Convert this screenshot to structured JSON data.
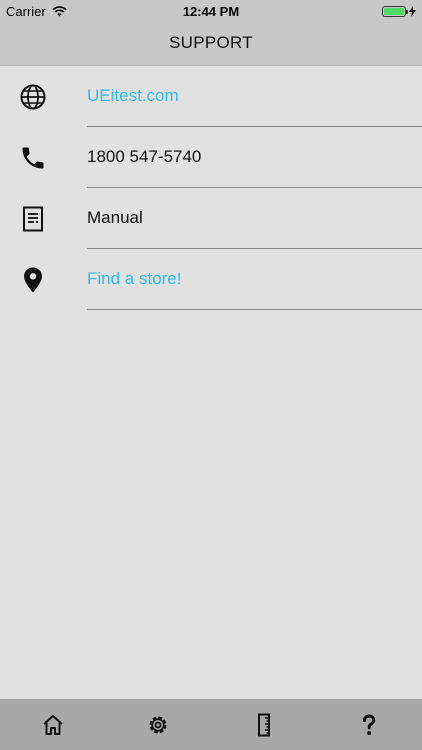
{
  "status_bar": {
    "carrier": "Carrier",
    "time": "12:44 PM"
  },
  "nav": {
    "title": "SUPPORT"
  },
  "support_items": [
    {
      "label": "UEitest.com",
      "icon": "globe-icon",
      "link": true
    },
    {
      "label": "1800 547-5740",
      "icon": "phone-icon",
      "link": false
    },
    {
      "label": "Manual",
      "icon": "document-icon",
      "link": false
    },
    {
      "label": "Find a store!",
      "icon": "location-pin-icon",
      "link": true
    }
  ],
  "tab_bar": {
    "tabs": [
      {
        "icon": "home-icon"
      },
      {
        "icon": "gear-icon"
      },
      {
        "icon": "ruler-icon"
      },
      {
        "icon": "question-icon"
      }
    ]
  },
  "colors": {
    "link": "#36b8e8",
    "background": "#e1e1e1",
    "nav_background": "#c8c8c8",
    "tab_background": "#a8a8a8",
    "battery": "#4cd964"
  }
}
